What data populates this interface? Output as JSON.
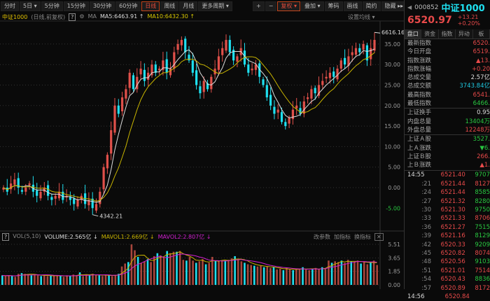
{
  "toolbar": {
    "left": [
      "分时",
      "5日 ▾",
      "5分钟",
      "15分钟",
      "30分钟",
      "60分钟",
      "日线",
      "周线",
      "月线",
      "更多周期 ▾"
    ],
    "active": "日线",
    "right": [
      "+",
      "−",
      "复权 ▾",
      "叠加 ▾",
      "筹码",
      "画线",
      "简约",
      "隐藏 ▸▸",
      "⛶"
    ]
  },
  "info": {
    "name": "中证1000",
    "mode": "(日线,前复权)",
    "help": "?",
    "ma": "MA",
    "ma5": "MA5:6463.91 ↑",
    "ma10": "MA10:6432.30 ↑",
    "set_ma": "设置均线 ▾"
  },
  "colors": {
    "up": "#e0504a",
    "down": "#1ee0f0",
    "ma5": "#dcdcdc",
    "ma10": "#c8b400",
    "mavol2": "#d020d0",
    "vol_up": "#a8463c"
  },
  "chart_data": {
    "type": "candlestick",
    "ylim": [
      -7,
      39
    ],
    "y_ticks": [
      "35.00",
      "30.00",
      "25.00",
      "20.00",
      "15.00",
      "10.00",
      "5.00",
      "0.00",
      "-5.00"
    ],
    "y_tick_values": [
      35,
      30,
      25,
      20,
      15,
      10,
      5,
      0,
      -5
    ],
    "closes": [
      0,
      -1,
      1,
      2,
      0,
      -1,
      0,
      1,
      -1,
      -2,
      -1,
      0,
      -2,
      -3,
      -2,
      -1,
      -3,
      -2,
      -3,
      -4,
      -3,
      -2,
      -4,
      -3,
      -5,
      -4,
      -1,
      5,
      8,
      14,
      20,
      18,
      22,
      24,
      28,
      24,
      27,
      29,
      26,
      28,
      30,
      28,
      29,
      31,
      28,
      29,
      33,
      35,
      36,
      33,
      31,
      28,
      25,
      23,
      26,
      24,
      27,
      29,
      32,
      34,
      36,
      33,
      31,
      32,
      34,
      30,
      28,
      29,
      30,
      27,
      25,
      22,
      20,
      18,
      19,
      16,
      15,
      17,
      19,
      20,
      18,
      21,
      22,
      24,
      23,
      25,
      26,
      27,
      28,
      27,
      29,
      31,
      30,
      32,
      33,
      34,
      33,
      35,
      31,
      34,
      36
    ],
    "annotations": {
      "high": "6616.16",
      "low": "4342.21"
    },
    "volume": {
      "ylim": [
        0,
        5.8
      ],
      "y_ticks": [
        "5.51",
        "3.65",
        "1.85",
        "0.00"
      ],
      "y_tick_values": [
        5.51,
        3.65,
        1.85,
        0
      ],
      "values": [
        1.3,
        1.2,
        1.3,
        1.2,
        1.1,
        1.5,
        1.6,
        1.5,
        1.4,
        1.3,
        1.4,
        1.3,
        1.2,
        1.3,
        1.2,
        1.3,
        1.2,
        1.3,
        1.2,
        1.1,
        1.3,
        1.2,
        1.4,
        1.3,
        1.7,
        1.2,
        1.4,
        1.3,
        1.5,
        1.3,
        1.3,
        1.2,
        1.4,
        1.3,
        1.2,
        1.3,
        1.5,
        2.5,
        2.9,
        3.1,
        5.5,
        4.7,
        3.8,
        3.0,
        3.2,
        3.5,
        3.1,
        3.9,
        4.3,
        4.0,
        3.8,
        4.6,
        4.3,
        4.5,
        4.5,
        4.6,
        3.4,
        3.3,
        3.8,
        3.3,
        3.0,
        3.2,
        3.5,
        2.8,
        3.0,
        3.8,
        3.3,
        3.2,
        3.3,
        3.3,
        3.4,
        3.6,
        3.9,
        3.4,
        3.2,
        3.0,
        2.8,
        2.7,
        2.6,
        2.5,
        2.6,
        2.4,
        2.5,
        2.3,
        2.4,
        2.1,
        2.2,
        2.0,
        2.3,
        2.1,
        2.0,
        2.1,
        2.2,
        2.4,
        2.1,
        2.0,
        2.2,
        2.3,
        2.1,
        2.4,
        2.2,
        3.3,
        3.0,
        3.2,
        3.1,
        3.3,
        3.0,
        3.4,
        3.2,
        3.1,
        3.3,
        2.9,
        3.2,
        2.8,
        3.0,
        3.3,
        2.7
      ]
    }
  },
  "vol": {
    "help": "?",
    "name": "VOL(5,10)",
    "volume": "VOLUME:2.565亿 ↓",
    "mavol1": "MAVOL1:2.669亿 ↓",
    "mavol2": "MAVOL2:2.807亿 ↓",
    "btns": [
      "改参数",
      "加指标",
      "换指标",
      "✕"
    ]
  },
  "quote": {
    "code": "000852",
    "name": "中证1000",
    "price": "6520.97",
    "change": "+13.21",
    "pct": "+0.20%"
  },
  "tabs": [
    "盘口",
    "资金",
    "指数",
    "异动",
    "板"
  ],
  "stats1": [
    [
      "最新指数",
      "6520.",
      "red"
    ],
    [
      "今日开盘",
      "6519.",
      "red"
    ],
    [
      "指数涨跌",
      "▲13.",
      "red"
    ],
    [
      "指数涨幅",
      "+0.20",
      "red"
    ],
    [
      "总成交量",
      "2.57亿",
      "wht"
    ],
    [
      "总成交额",
      "3743.84亿",
      "cyan"
    ],
    [
      "最高指数",
      "6541.",
      "red"
    ],
    [
      "最低指数",
      "6466.",
      "grn"
    ]
  ],
  "stats2": [
    [
      "上证换手",
      "0.95",
      "wht"
    ],
    [
      "内盘总量",
      "13404万",
      "grn"
    ],
    [
      "外盘总量",
      "12248万",
      "red"
    ]
  ],
  "stats3": [
    [
      "上证Ａ股",
      "3527.",
      "grn"
    ],
    [
      "上Ａ涨跌",
      "▼6.",
      "grn"
    ],
    [
      "上证Ｂ股",
      "266.",
      "red"
    ],
    [
      "上Ｂ涨跌",
      "▲1.",
      "red"
    ]
  ],
  "ticks": {
    "time": "14:55",
    "rows": [
      [
        "",
        "6521.40",
        "9707"
      ],
      [
        ":21",
        "6521.44",
        "8127"
      ],
      [
        ":24",
        "6521.44",
        "8585"
      ],
      [
        ":27",
        "6521.32",
        "8280"
      ],
      [
        ":30",
        "6521.30",
        "9750"
      ],
      [
        ":33",
        "6521.33",
        "8706"
      ],
      [
        ":36",
        "6521.27",
        "7515"
      ],
      [
        ":39",
        "6521.16",
        "8129"
      ],
      [
        ":42",
        "6520.33",
        "9209"
      ],
      [
        ":45",
        "6520.82",
        "8074"
      ],
      [
        ":48",
        "6520.56",
        "9103"
      ],
      [
        ":51",
        "6521.01",
        "7514"
      ],
      [
        ":54",
        "6520.43",
        "8836"
      ],
      [
        ":57",
        "6520.89",
        "8172"
      ]
    ],
    "vol_colors": [
      "grn",
      "red",
      "grn",
      "grn",
      "grn",
      "red",
      "grn",
      "grn",
      "grn",
      "red",
      "grn",
      "red",
      "grn",
      "red"
    ],
    "next": "14:56",
    "next_price": "6520.84"
  }
}
